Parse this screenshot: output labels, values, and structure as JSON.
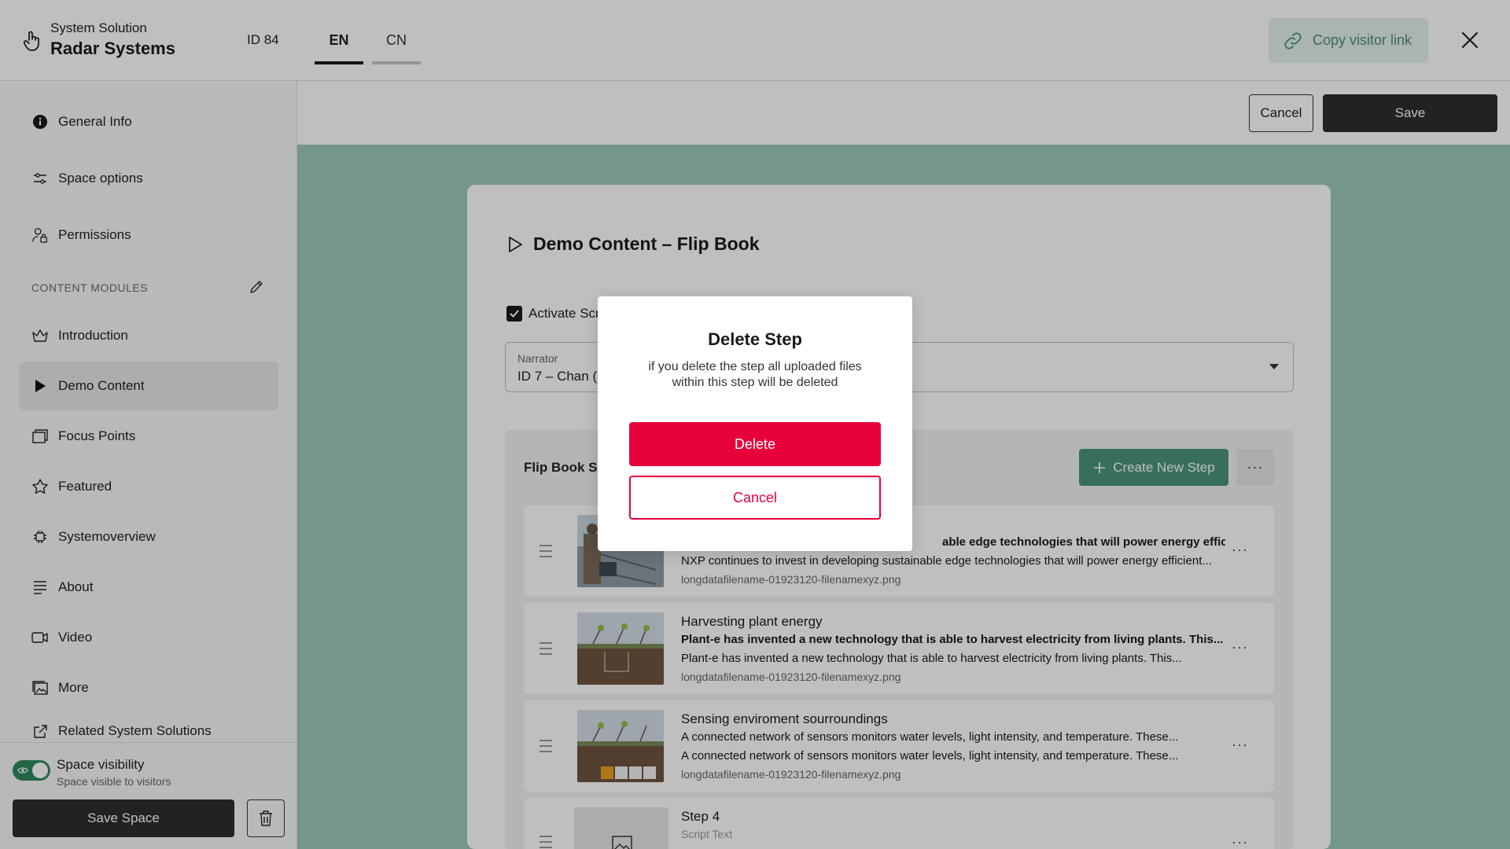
{
  "header": {
    "subtitle": "System Solution",
    "title": "Radar Systems",
    "id_label": "ID 84",
    "languages": [
      "EN",
      "CN"
    ],
    "active_language": "EN",
    "copy_link_label": "Copy visitor link"
  },
  "sidebar": {
    "items": [
      {
        "label": "General Info",
        "icon": "info-icon"
      },
      {
        "label": "Space options",
        "icon": "sliders-icon"
      },
      {
        "label": "Permissions",
        "icon": "user-lock-icon"
      }
    ],
    "section_label": "CONTENT MODULES",
    "modules": [
      {
        "label": "Introduction",
        "icon": "crown-icon"
      },
      {
        "label": "Demo Content",
        "icon": "play-icon",
        "active": true
      },
      {
        "label": "Focus Points",
        "icon": "window-icon"
      },
      {
        "label": "Featured",
        "icon": "star-icon"
      },
      {
        "label": "Systemoverview",
        "icon": "chip-icon"
      },
      {
        "label": "About",
        "icon": "list-icon"
      },
      {
        "label": "Video",
        "icon": "video-icon"
      },
      {
        "label": "More",
        "icon": "images-icon"
      },
      {
        "label": "Related System Solutions",
        "icon": "external-link-icon"
      }
    ],
    "visibility_title": "Space visibility",
    "visibility_sub": "Space visible to visitors",
    "visibility_on": true,
    "save_space_label": "Save Space"
  },
  "toolbar": {
    "cancel_label": "Cancel",
    "save_label": "Save"
  },
  "content": {
    "title": "Demo Content – Flip Book",
    "activate_label": "Activate Scr",
    "narrator_label": "Narrator",
    "narrator_value": "ID 7  – Chan (S",
    "steps_title": "Flip Book St",
    "create_step_label": "Create New Step",
    "steps": [
      {
        "title": "",
        "text_bold": "able edge technologies that will power energy efficient...",
        "text": "NXP continues to invest in developing sustainable edge technologies that will power energy efficient...",
        "file": "longdatafilename-01923120-filenamexyz.png"
      },
      {
        "title": "Harvesting plant energy",
        "text_bold": "Plant-e has invented a new technology that is able to harvest electricity from living plants. This...",
        "text": "Plant-e has invented a new technology that is able to harvest electricity from living plants. This...",
        "file": "longdatafilename-01923120-filenamexyz.png"
      },
      {
        "title": "Sensing enviroment sourroundings",
        "text_bold": "A connected network of sensors monitors water levels, light intensity, and temperature. These...",
        "text": "A connected network of sensors monitors water levels, light intensity, and temperature. These...",
        "file": "longdatafilename-01923120-filenamexyz.png"
      },
      {
        "title": "Step 4",
        "text_bold": "Script Text",
        "text": "",
        "file": ""
      }
    ]
  },
  "dialog": {
    "title": "Delete Step",
    "body": "if you delete the step all uploaded files within this step will be deleted",
    "delete_label": "Delete",
    "cancel_label": "Cancel"
  },
  "colors": {
    "accent_green": "#4b9478",
    "canvas_green": "#9dc9b8",
    "danger": "#e8003d",
    "dark": "#2e2e2e"
  }
}
